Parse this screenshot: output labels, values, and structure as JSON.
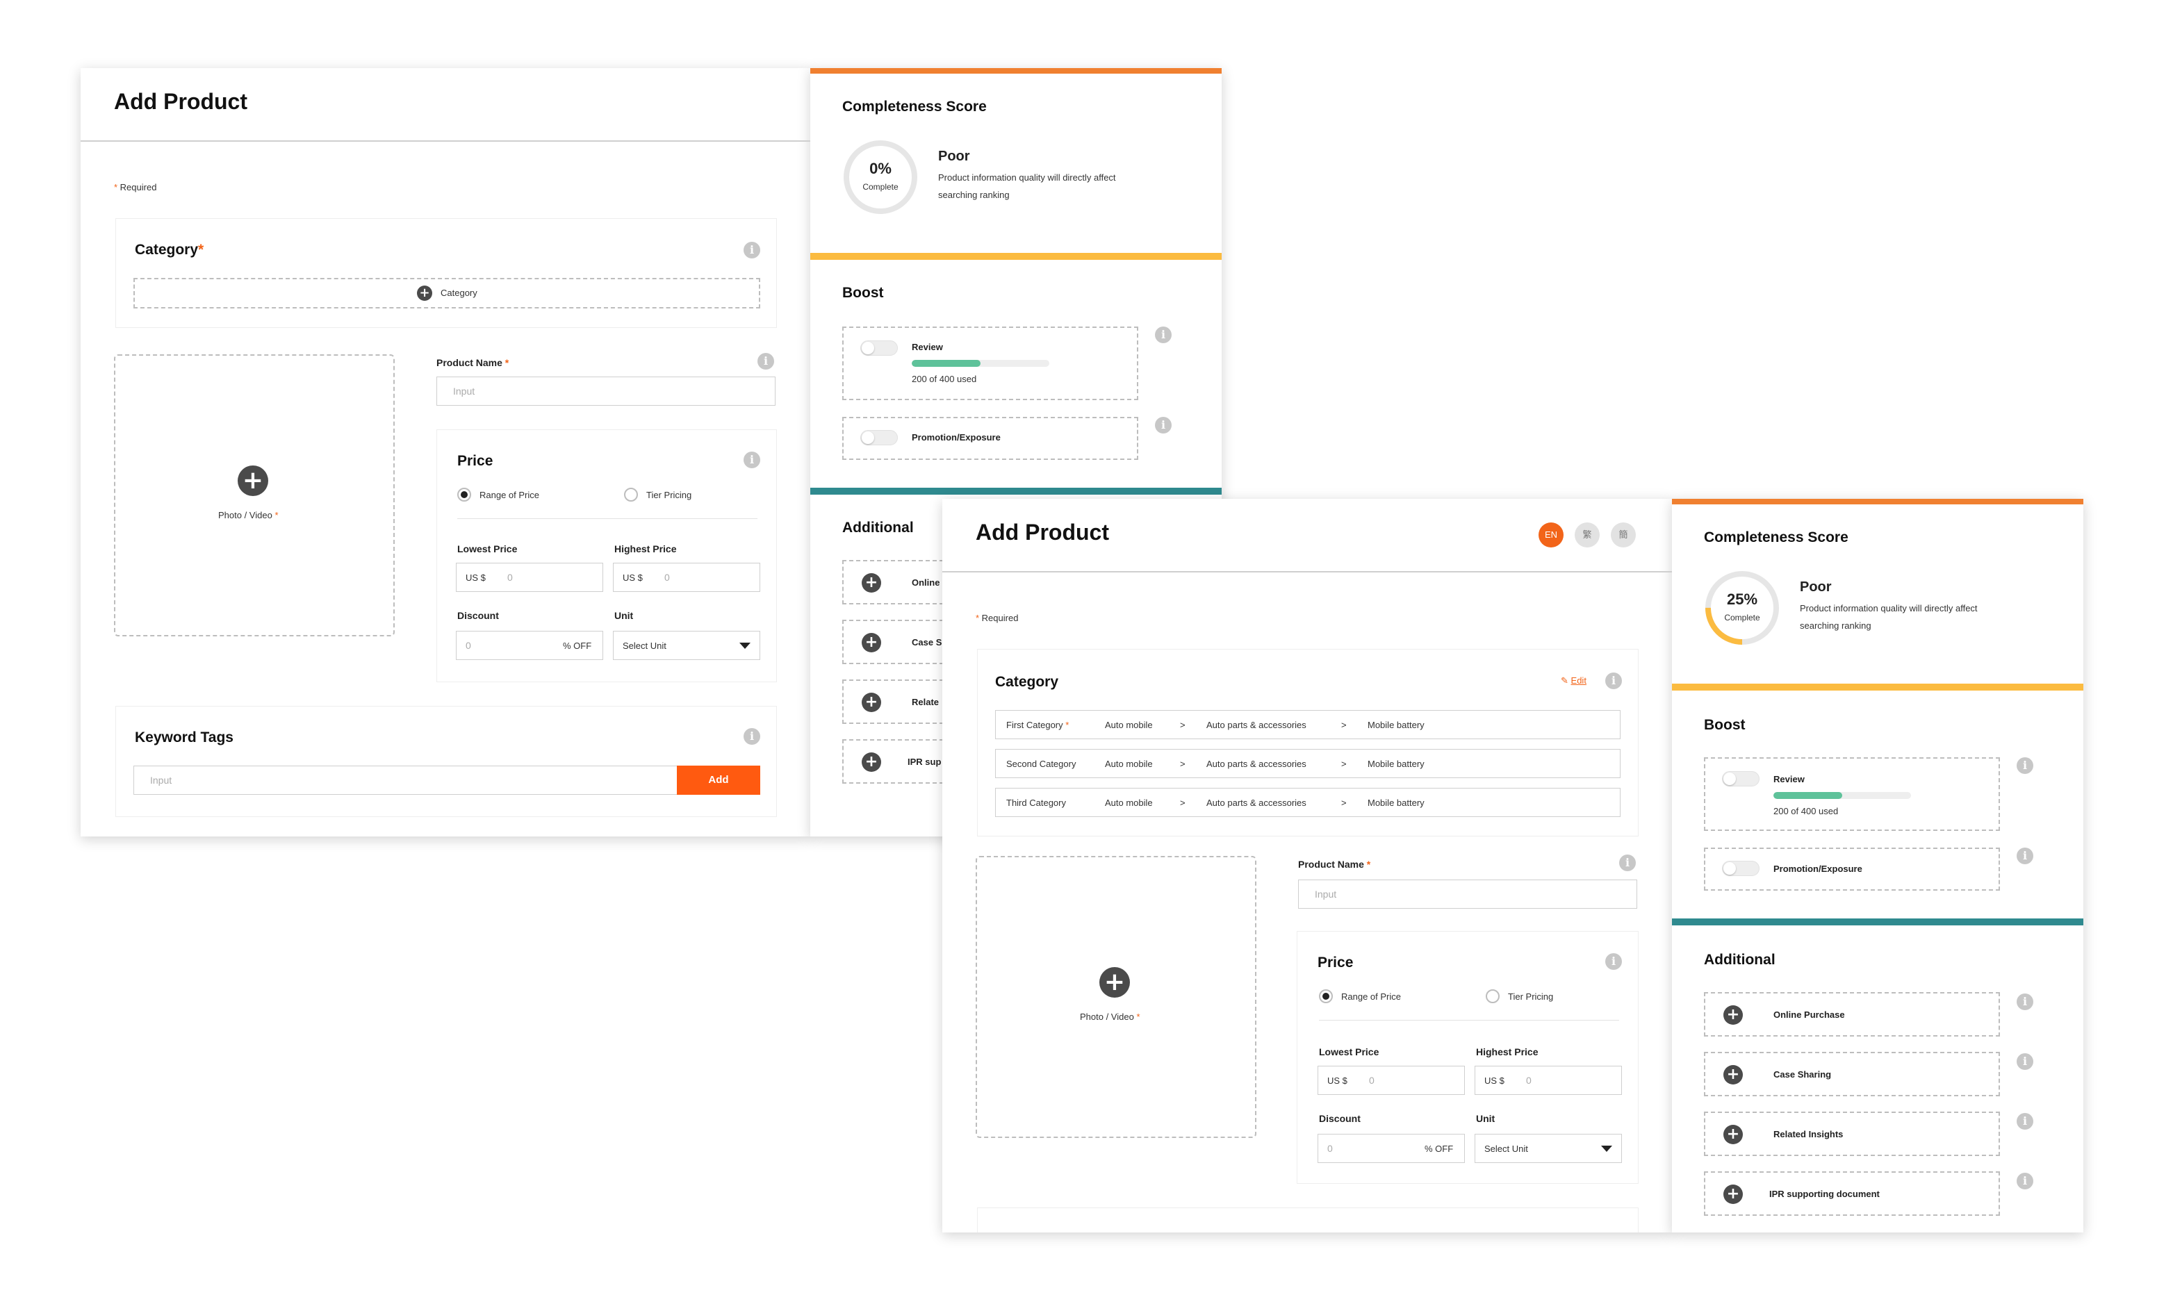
{
  "colors": {
    "accent": "#f26419",
    "orange_bar": "#f08030",
    "yellow_bar": "#fbbb40",
    "teal_bar": "#2f8a8f",
    "progress": "#5ec29a",
    "add_button": "#ff5a10"
  },
  "left": {
    "header": {
      "title": "Add Product"
    },
    "required_note": "Required",
    "category": {
      "title": "Category",
      "add_label": "Category"
    },
    "photo": {
      "label": "Photo / Video"
    },
    "product_name": {
      "label": "Product Name",
      "placeholder": "Input"
    },
    "price": {
      "title": "Price",
      "range_label": "Range of Price",
      "tier_label": "Tier Pricing",
      "lowest_label": "Lowest Price",
      "highest_label": "Highest Price",
      "currency": "US $",
      "lowest_placeholder": "0",
      "highest_placeholder": "0",
      "discount_label": "Discount",
      "discount_placeholder": "0",
      "discount_suffix": "% OFF",
      "unit_label": "Unit",
      "unit_value": "Select Unit"
    },
    "keywords": {
      "title": "Keyword Tags",
      "placeholder": "Input",
      "add_label": "Add"
    },
    "score": {
      "title": "Completeness Score",
      "percent": "0%",
      "percent_value": 0,
      "complete_label": "Complete",
      "rating": "Poor",
      "desc_line1": "Product information quality will directly affect",
      "desc_line2": "searching ranking"
    },
    "boost": {
      "title": "Boost",
      "review_label": "Review",
      "review_usage": "200 of 400 used",
      "review_fraction": 0.5,
      "promotion_label": "Promotion/Exposure"
    },
    "additional": {
      "title": "Additional",
      "items": [
        "Online",
        "Case S",
        "Relate",
        "IPR sup"
      ]
    }
  },
  "right": {
    "header": {
      "title": "Add Product"
    },
    "languages": [
      "EN",
      "繁",
      "簡"
    ],
    "required_note": "Required",
    "category": {
      "title": "Category",
      "edit_label": "Edit",
      "rows": [
        {
          "label": "First Category",
          "l1": "Auto mobile",
          "l2": "Auto parts & accessories",
          "l3": "Mobile battery"
        },
        {
          "label": "Second Category",
          "l1": "Auto mobile",
          "l2": "Auto parts & accessories",
          "l3": "Mobile battery"
        },
        {
          "label": "Third Category",
          "l1": "Auto mobile",
          "l2": "Auto parts & accessories",
          "l3": "Mobile battery"
        }
      ],
      "separator": ">"
    },
    "photo": {
      "label": "Photo / Video"
    },
    "product_name": {
      "label": "Product Name",
      "placeholder": "Input"
    },
    "price": {
      "title": "Price",
      "range_label": "Range of Price",
      "tier_label": "Tier Pricing",
      "lowest_label": "Lowest Price",
      "highest_label": "Highest Price",
      "currency": "US $",
      "lowest_placeholder": "0",
      "highest_placeholder": "0",
      "discount_label": "Discount",
      "discount_placeholder": "0",
      "discount_suffix": "% OFF",
      "unit_label": "Unit",
      "unit_value": "Select Unit"
    },
    "score": {
      "title": "Completeness Score",
      "percent": "25%",
      "percent_value": 25,
      "complete_label": "Complete",
      "rating": "Poor",
      "desc_line1": "Product information quality will directly affect",
      "desc_line2": "searching ranking"
    },
    "boost": {
      "title": "Boost",
      "review_label": "Review",
      "review_usage": "200 of 400 used",
      "review_fraction": 0.5,
      "promotion_label": "Promotion/Exposure"
    },
    "additional": {
      "title": "Additional",
      "items": [
        "Online Purchase",
        "Case Sharing",
        "Related Insights",
        "IPR supporting document"
      ]
    }
  }
}
